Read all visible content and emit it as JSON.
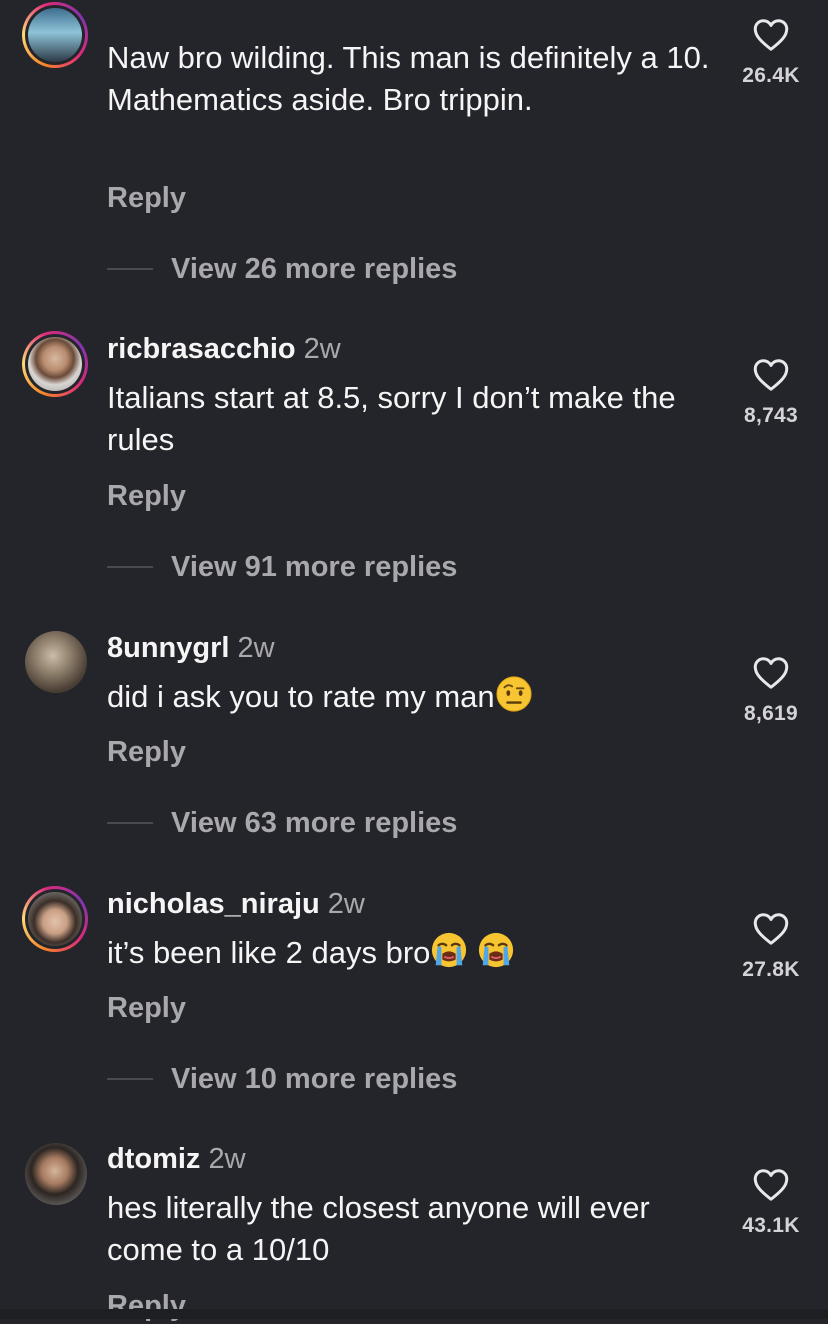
{
  "comments": [
    {
      "username": "",
      "time": "",
      "text": "Naw bro wilding. This man is definitely a 10. Mathematics aside. Bro trippin.",
      "likes": "26.4K",
      "reply_label": "Reply",
      "view_replies": "View 26 more replies"
    },
    {
      "username": "ricbrasacchio",
      "time": "2w",
      "text": "Italians start at 8.5, sorry I don’t make the rules",
      "likes": "8,743",
      "reply_label": "Reply",
      "view_replies": "View 91 more replies"
    },
    {
      "username": "8unnygrl",
      "time": "2w",
      "text": "did i ask you to rate my man",
      "emoji": [
        "face-with-raised-eyebrow-emoji"
      ],
      "likes": "8,619",
      "reply_label": "Reply",
      "view_replies": "View 63 more replies"
    },
    {
      "username": "nicholas_niraju",
      "time": "2w",
      "text": "it’s been like 2 days bro",
      "emoji": [
        "loudly-crying-face-emoji",
        "loudly-crying-face-emoji"
      ],
      "likes": "27.8K",
      "reply_label": "Reply",
      "view_replies": "View 10 more replies"
    },
    {
      "username": "dtomiz",
      "time": "2w",
      "text": "hes literally the closest anyone will ever come to a 10/10",
      "likes": "43.1K",
      "reply_label": "Reply"
    }
  ],
  "colors": {
    "background": "#24252a",
    "primary_text": "#f5f5f5",
    "secondary_text": "#a8a8ad",
    "story_ring": [
      "#f58529",
      "#feda77",
      "#dd2a7b",
      "#8134af"
    ]
  },
  "icons": {
    "like": "heart-outline-icon",
    "avatar": "user-avatar"
  }
}
